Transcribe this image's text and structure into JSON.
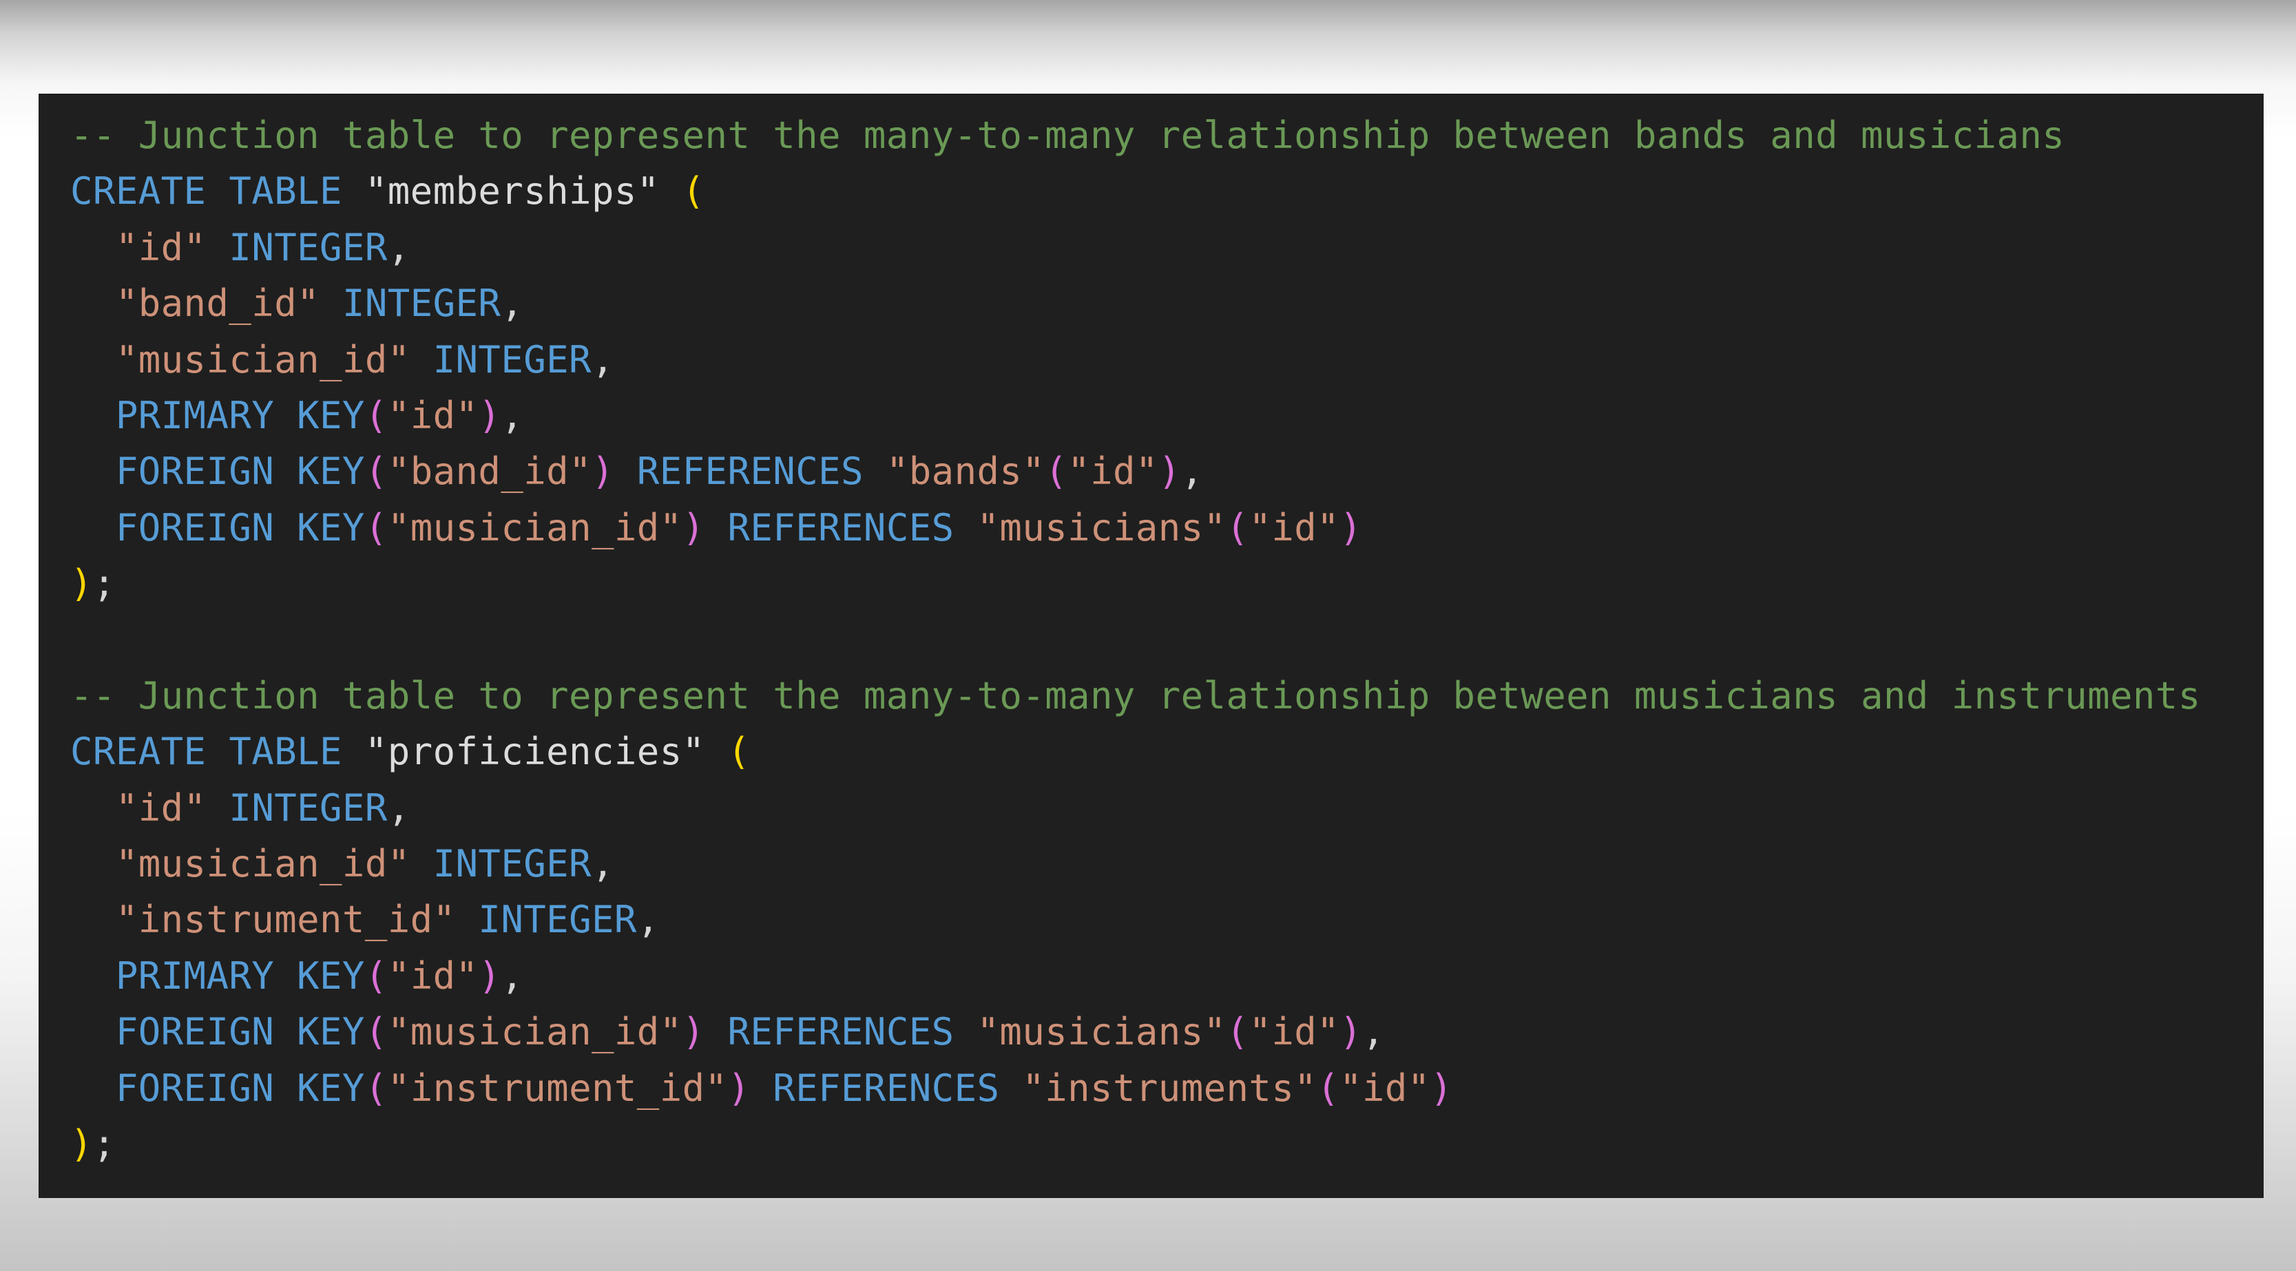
{
  "colors": {
    "background": "#1f1f1f",
    "comment": "#6a9955",
    "keyword": "#569cd6",
    "string": "#ce9178",
    "table_name": "#dcdcdc",
    "bracket_level_1": "#ffd700",
    "bracket_level_2": "#da70d6",
    "punctuation": "#d4d4d4"
  },
  "code": {
    "lines": [
      [
        {
          "text": "-- Junction table to represent the many-to-many relationship between bands and musicians",
          "type": "comment"
        }
      ],
      [
        {
          "text": "CREATE TABLE",
          "type": "keyword"
        },
        {
          "text": " ",
          "type": "punct"
        },
        {
          "text": "\"memberships\"",
          "type": "ident"
        },
        {
          "text": " ",
          "type": "punct"
        },
        {
          "text": "(",
          "type": "paren1"
        }
      ],
      [
        {
          "text": "  ",
          "type": "punct"
        },
        {
          "text": "\"id\"",
          "type": "string"
        },
        {
          "text": " ",
          "type": "punct"
        },
        {
          "text": "INTEGER",
          "type": "keyword"
        },
        {
          "text": ",",
          "type": "punct"
        }
      ],
      [
        {
          "text": "  ",
          "type": "punct"
        },
        {
          "text": "\"band_id\"",
          "type": "string"
        },
        {
          "text": " ",
          "type": "punct"
        },
        {
          "text": "INTEGER",
          "type": "keyword"
        },
        {
          "text": ",",
          "type": "punct"
        }
      ],
      [
        {
          "text": "  ",
          "type": "punct"
        },
        {
          "text": "\"musician_id\"",
          "type": "string"
        },
        {
          "text": " ",
          "type": "punct"
        },
        {
          "text": "INTEGER",
          "type": "keyword"
        },
        {
          "text": ",",
          "type": "punct"
        }
      ],
      [
        {
          "text": "  ",
          "type": "punct"
        },
        {
          "text": "PRIMARY KEY",
          "type": "keyword"
        },
        {
          "text": "(",
          "type": "paren2"
        },
        {
          "text": "\"id\"",
          "type": "string"
        },
        {
          "text": ")",
          "type": "paren2"
        },
        {
          "text": ",",
          "type": "punct"
        }
      ],
      [
        {
          "text": "  ",
          "type": "punct"
        },
        {
          "text": "FOREIGN KEY",
          "type": "keyword"
        },
        {
          "text": "(",
          "type": "paren2"
        },
        {
          "text": "\"band_id\"",
          "type": "string"
        },
        {
          "text": ")",
          "type": "paren2"
        },
        {
          "text": " ",
          "type": "punct"
        },
        {
          "text": "REFERENCES",
          "type": "keyword"
        },
        {
          "text": " ",
          "type": "punct"
        },
        {
          "text": "\"bands\"",
          "type": "string"
        },
        {
          "text": "(",
          "type": "paren2"
        },
        {
          "text": "\"id\"",
          "type": "string"
        },
        {
          "text": ")",
          "type": "paren2"
        },
        {
          "text": ",",
          "type": "punct"
        }
      ],
      [
        {
          "text": "  ",
          "type": "punct"
        },
        {
          "text": "FOREIGN KEY",
          "type": "keyword"
        },
        {
          "text": "(",
          "type": "paren2"
        },
        {
          "text": "\"musician_id\"",
          "type": "string"
        },
        {
          "text": ")",
          "type": "paren2"
        },
        {
          "text": " ",
          "type": "punct"
        },
        {
          "text": "REFERENCES",
          "type": "keyword"
        },
        {
          "text": " ",
          "type": "punct"
        },
        {
          "text": "\"musicians\"",
          "type": "string"
        },
        {
          "text": "(",
          "type": "paren2"
        },
        {
          "text": "\"id\"",
          "type": "string"
        },
        {
          "text": ")",
          "type": "paren2"
        }
      ],
      [
        {
          "text": ")",
          "type": "paren1"
        },
        {
          "text": ";",
          "type": "punct"
        }
      ],
      [],
      [
        {
          "text": "-- Junction table to represent the many-to-many relationship between musicians and instruments",
          "type": "comment"
        }
      ],
      [
        {
          "text": "CREATE TABLE",
          "type": "keyword"
        },
        {
          "text": " ",
          "type": "punct"
        },
        {
          "text": "\"proficiencies\"",
          "type": "ident"
        },
        {
          "text": " ",
          "type": "punct"
        },
        {
          "text": "(",
          "type": "paren1"
        }
      ],
      [
        {
          "text": "  ",
          "type": "punct"
        },
        {
          "text": "\"id\"",
          "type": "string"
        },
        {
          "text": " ",
          "type": "punct"
        },
        {
          "text": "INTEGER",
          "type": "keyword"
        },
        {
          "text": ",",
          "type": "punct"
        }
      ],
      [
        {
          "text": "  ",
          "type": "punct"
        },
        {
          "text": "\"musician_id\"",
          "type": "string"
        },
        {
          "text": " ",
          "type": "punct"
        },
        {
          "text": "INTEGER",
          "type": "keyword"
        },
        {
          "text": ",",
          "type": "punct"
        }
      ],
      [
        {
          "text": "  ",
          "type": "punct"
        },
        {
          "text": "\"instrument_id\"",
          "type": "string"
        },
        {
          "text": " ",
          "type": "punct"
        },
        {
          "text": "INTEGER",
          "type": "keyword"
        },
        {
          "text": ",",
          "type": "punct"
        }
      ],
      [
        {
          "text": "  ",
          "type": "punct"
        },
        {
          "text": "PRIMARY KEY",
          "type": "keyword"
        },
        {
          "text": "(",
          "type": "paren2"
        },
        {
          "text": "\"id\"",
          "type": "string"
        },
        {
          "text": ")",
          "type": "paren2"
        },
        {
          "text": ",",
          "type": "punct"
        }
      ],
      [
        {
          "text": "  ",
          "type": "punct"
        },
        {
          "text": "FOREIGN KEY",
          "type": "keyword"
        },
        {
          "text": "(",
          "type": "paren2"
        },
        {
          "text": "\"musician_id\"",
          "type": "string"
        },
        {
          "text": ")",
          "type": "paren2"
        },
        {
          "text": " ",
          "type": "punct"
        },
        {
          "text": "REFERENCES",
          "type": "keyword"
        },
        {
          "text": " ",
          "type": "punct"
        },
        {
          "text": "\"musicians\"",
          "type": "string"
        },
        {
          "text": "(",
          "type": "paren2"
        },
        {
          "text": "\"id\"",
          "type": "string"
        },
        {
          "text": ")",
          "type": "paren2"
        },
        {
          "text": ",",
          "type": "punct"
        }
      ],
      [
        {
          "text": "  ",
          "type": "punct"
        },
        {
          "text": "FOREIGN KEY",
          "type": "keyword"
        },
        {
          "text": "(",
          "type": "paren2"
        },
        {
          "text": "\"instrument_id\"",
          "type": "string"
        },
        {
          "text": ")",
          "type": "paren2"
        },
        {
          "text": " ",
          "type": "punct"
        },
        {
          "text": "REFERENCES",
          "type": "keyword"
        },
        {
          "text": " ",
          "type": "punct"
        },
        {
          "text": "\"instruments\"",
          "type": "string"
        },
        {
          "text": "(",
          "type": "paren2"
        },
        {
          "text": "\"id\"",
          "type": "string"
        },
        {
          "text": ")",
          "type": "paren2"
        }
      ],
      [
        {
          "text": ")",
          "type": "paren1"
        },
        {
          "text": ";",
          "type": "punct"
        }
      ]
    ]
  }
}
